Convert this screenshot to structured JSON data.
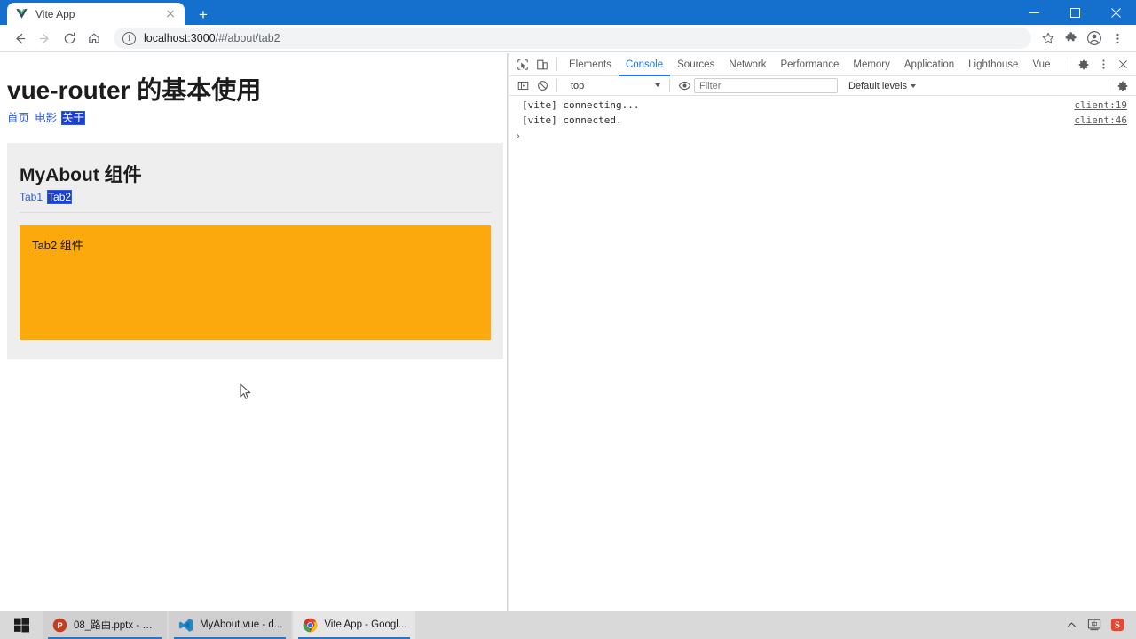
{
  "window": {
    "minimize_label": "Minimize",
    "maximize_label": "Maximize",
    "close_label": "Close"
  },
  "browser": {
    "tab": {
      "title": "Vite App",
      "favicon": "vue-logo-icon",
      "close_label": "×"
    },
    "new_tab_label": "+",
    "toolbar": {
      "back_label": "Back",
      "forward_label": "Forward",
      "reload_label": "Reload",
      "home_label": "Home",
      "url_scheme_host": "localhost:3000",
      "url_path": "/#/about/tab2",
      "url_full": "localhost:3000/#/about/tab2",
      "info_glyph": "i",
      "bookmark_label": "Bookmark this tab",
      "extensions_label": "Extensions",
      "profile_label": "Profile",
      "menu_label": "Customize and control Google Chrome"
    }
  },
  "page": {
    "heading": "vue-router 的基本使用",
    "nav": [
      {
        "label": "首页",
        "active": false
      },
      {
        "label": "电影",
        "active": false
      },
      {
        "label": "关于",
        "active": true
      }
    ],
    "card": {
      "title": "MyAbout 组件",
      "tabs": [
        {
          "label": "Tab1",
          "active": false
        },
        {
          "label": "Tab2",
          "active": true
        }
      ],
      "panel": {
        "title": "Tab2 组件",
        "background_color": "#fca90d"
      }
    }
  },
  "devtools": {
    "inspect_label": "Inspect element",
    "device_toolbar_label": "Toggle device toolbar",
    "tabs": [
      {
        "label": "Elements",
        "active": false
      },
      {
        "label": "Console",
        "active": true
      },
      {
        "label": "Sources",
        "active": false
      },
      {
        "label": "Network",
        "active": false
      },
      {
        "label": "Performance",
        "active": false
      },
      {
        "label": "Memory",
        "active": false
      },
      {
        "label": "Application",
        "active": false
      },
      {
        "label": "Lighthouse",
        "active": false
      },
      {
        "label": "Vue",
        "active": false
      }
    ],
    "settings_label": "Settings",
    "more_label": "More options",
    "close_label": "Close DevTools",
    "console_toolbar": {
      "sidebar_label": "Show console sidebar",
      "clear_label": "Clear console",
      "context": "top",
      "eye_label": "Create live expression",
      "filter_placeholder": "Filter",
      "filter_value": "",
      "levels": "Default levels",
      "settings_label": "Console settings"
    },
    "console_messages": [
      {
        "text": "[vite] connecting...",
        "source": "client:19"
      },
      {
        "text": "[vite] connected.",
        "source": "client:46"
      }
    ],
    "prompt_glyph": "›"
  },
  "taskbar": {
    "start_label": "Start",
    "items": [
      {
        "label": "08_路由.pptx - Po...",
        "icon": "powerpoint-icon",
        "active": false
      },
      {
        "label": "MyAbout.vue - d...",
        "icon": "vscode-icon",
        "active": false
      },
      {
        "label": "Vite App - Googl...",
        "icon": "chrome-icon",
        "active": true
      }
    ],
    "tray": [
      {
        "name": "show-hidden-icons",
        "glyph": "⌃"
      },
      {
        "name": "ime-language-icon",
        "glyph": "中"
      },
      {
        "name": "sogou-input-icon",
        "glyph": "S"
      }
    ]
  }
}
